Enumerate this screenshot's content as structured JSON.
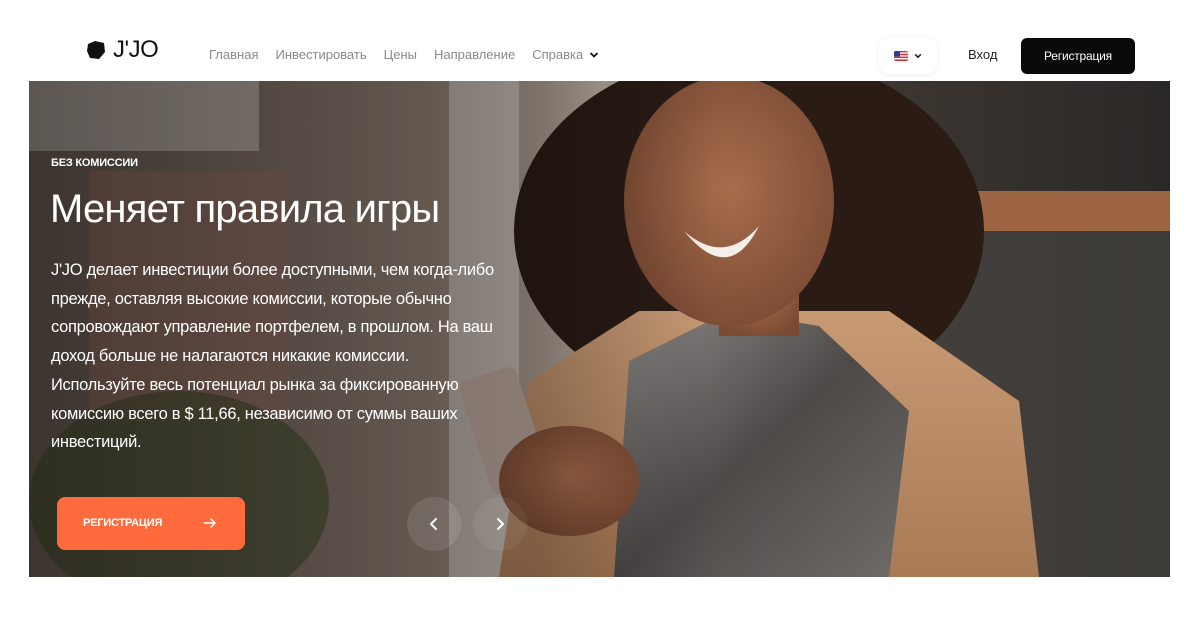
{
  "brand": {
    "name": "J'JO"
  },
  "nav": {
    "items": [
      {
        "label": "Главная"
      },
      {
        "label": "Инвестировать"
      },
      {
        "label": "Цены"
      },
      {
        "label": "Направление"
      },
      {
        "label": "Справка"
      }
    ],
    "language": {
      "icon": "us-flag-icon"
    },
    "login_label": "Вход",
    "signup_label": "Регистрация"
  },
  "hero": {
    "badge": "БЕЗ КОМИССИИ",
    "title": "Меняет правила игры",
    "description": "J'JO делает инвестиции более доступными, чем когда-либо прежде, оставляя высокие комиссии, которые обычно сопровождают управление портфелем, в прошлом. На ваш доход больше не налагаются никакие комиссии. Используйте весь потенциал рынка за фиксированную комиссию всего в $ 11,66, независимо от суммы ваших инвестиций.",
    "cta_label": "РЕГИСТРАЦИЯ",
    "icons": {
      "cta": "arrow-right-icon",
      "prev": "chevron-left-icon",
      "next": "chevron-right-icon"
    }
  },
  "colors": {
    "accent": "#ff6b3d",
    "signup_bg": "#0a0a0a",
    "nav_text": "#8a8a8a"
  }
}
